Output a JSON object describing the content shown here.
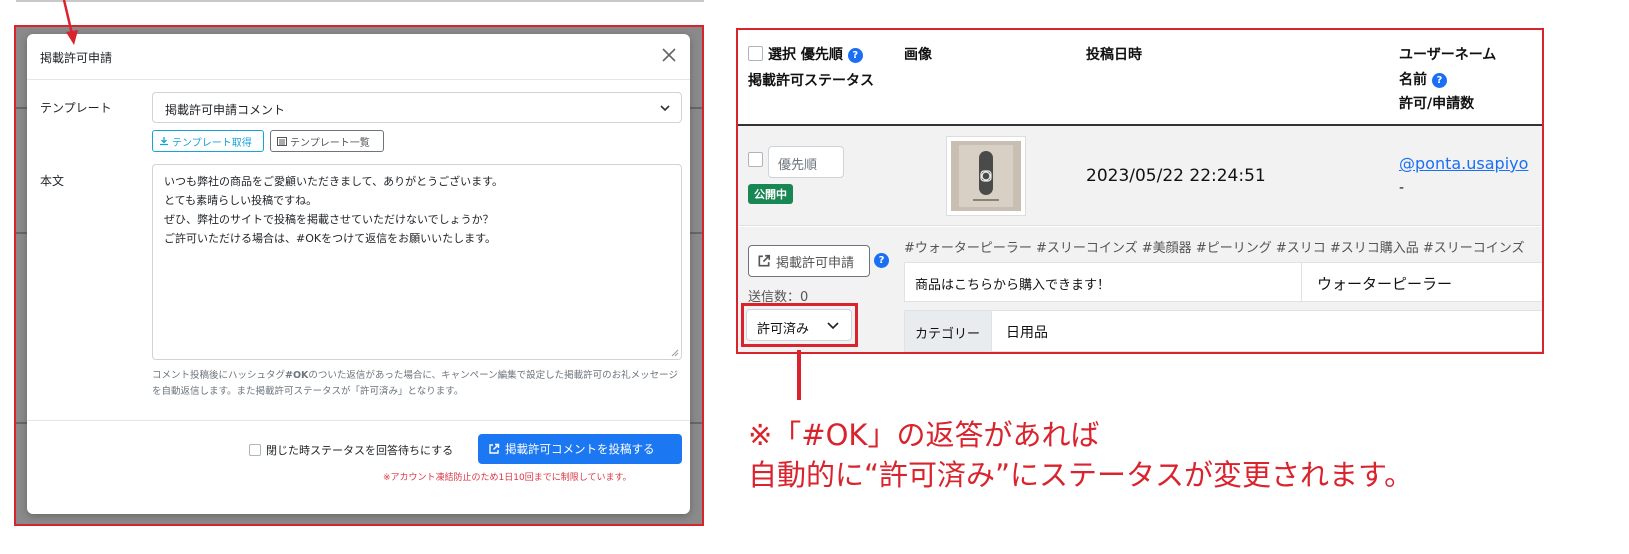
{
  "modal": {
    "title": "掲載許可申請",
    "template_label": "テンプレート",
    "template_value": "掲載許可申請コメント",
    "get_template_button": "テンプレート取得",
    "template_list_button": "テンプレート一覧",
    "body_label": "本文",
    "body_lines": [
      "いつも弊社の商品をご愛顧いただきまして、ありがとうございます。",
      "とても素晴らしい投稿ですね。",
      "ぜひ、弊社のサイトで投稿を掲載させていただけないでしょうか？",
      "ご許可いただける場合は、#OKをつけて返信をお願いいたします。"
    ],
    "help_pre": "コメント投稿後にハッシュタグ",
    "help_tag": "#OK",
    "help_post": "のついた返信があった場合に、キャンペーン編集で設定した掲載許可のお礼メッセージを自動返信します。また掲載許可ステータスが「許可済み」となります。",
    "close_check_label": "閉じた時ステータスを回答待ちにする",
    "post_button": "掲載許可コメントを投稿する",
    "limit_note": "※アカウント凍結防止のため1日10回までに制限しています。"
  },
  "table": {
    "headers": {
      "select": "選択",
      "priority": "優先順",
      "permission_status": "掲載許可ステータス",
      "image": "画像",
      "post_date": "投稿日時",
      "username": "ユーザーネーム",
      "name": "名前",
      "permit_count": "許可/申請数"
    },
    "row": {
      "priority_placeholder": "優先順",
      "status_badge": "公開中",
      "post_date": "2023/05/22 22:24:51",
      "username": "@ponta.usapiyo",
      "name": "-",
      "request_button": "掲載許可申請",
      "sent_count": "送信数：0",
      "status_select": "許可済み",
      "hashtags": "#ウォーターピーラー #スリーコインズ #美顔器 #ピーリング #スリコ #スリコ購入品 #スリーコインズ",
      "description": "商品はこちらから購入できます！",
      "product": "ウォーターピーラー",
      "category_label": "カテゴリー",
      "category_value": "日用品"
    }
  },
  "annotation": {
    "line1": "※「#OK」の返答があれば",
    "line2": "自動的に“許可済み”にステータスが変更されます。"
  },
  "colors": {
    "annotation_red": "#d9232d",
    "primary_blue": "#1b77f2",
    "badge_green": "#198754",
    "link_blue": "#1b6ff5"
  }
}
